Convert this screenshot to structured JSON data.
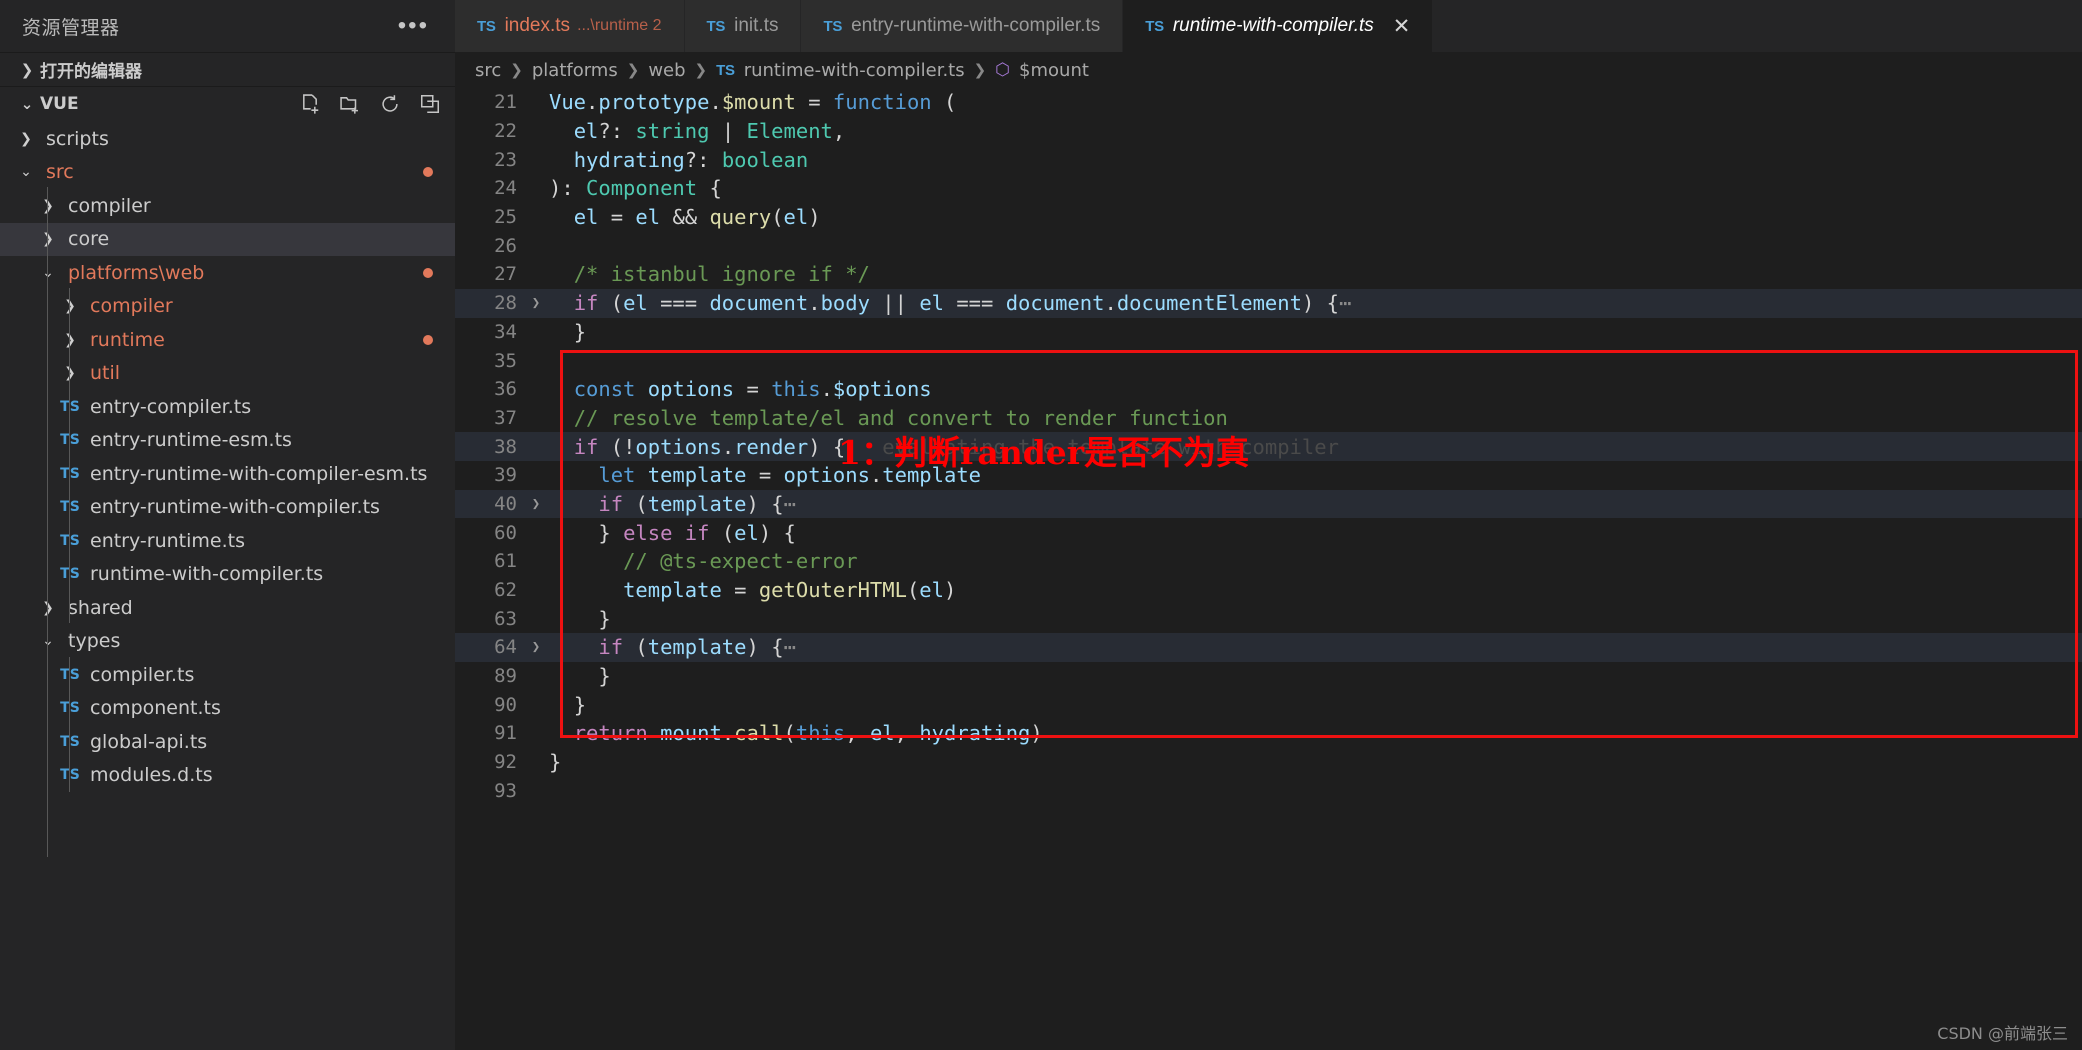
{
  "sidebar": {
    "title": "资源管理器",
    "more_label": "•••",
    "open_editors": {
      "label": "打开的编辑器",
      "chevron": "❯"
    },
    "project": {
      "label": "VUE",
      "chevron": "⌄",
      "actions": [
        "new-file-icon",
        "new-folder-icon",
        "refresh-icon",
        "collapse-all-icon"
      ]
    },
    "items": [
      {
        "name": "scripts",
        "type": "folder",
        "depth": 1,
        "state": "collapsed",
        "modified": false,
        "color": "normal"
      },
      {
        "name": "src",
        "type": "folder",
        "depth": 1,
        "state": "expanded",
        "modified": true,
        "color": "mod"
      },
      {
        "name": "compiler",
        "type": "folder",
        "depth": 2,
        "state": "collapsed",
        "modified": false,
        "color": "normal"
      },
      {
        "name": "core",
        "type": "folder",
        "depth": 2,
        "state": "collapsed",
        "modified": false,
        "color": "normal",
        "selected": true
      },
      {
        "name": "platforms\\web",
        "type": "folder",
        "depth": 2,
        "state": "expanded",
        "modified": true,
        "color": "mod"
      },
      {
        "name": "compiler",
        "type": "folder",
        "depth": 3,
        "state": "collapsed",
        "modified": false,
        "color": "mod"
      },
      {
        "name": "runtime",
        "type": "folder",
        "depth": 3,
        "state": "collapsed",
        "modified": true,
        "color": "mod"
      },
      {
        "name": "util",
        "type": "folder",
        "depth": 3,
        "state": "collapsed",
        "modified": false,
        "color": "mod"
      },
      {
        "name": "entry-compiler.ts",
        "type": "file",
        "depth": 3,
        "modified": false,
        "color": "normal"
      },
      {
        "name": "entry-runtime-esm.ts",
        "type": "file",
        "depth": 3,
        "modified": false,
        "color": "normal"
      },
      {
        "name": "entry-runtime-with-compiler-esm.ts",
        "type": "file",
        "depth": 3,
        "modified": false,
        "color": "normal"
      },
      {
        "name": "entry-runtime-with-compiler.ts",
        "type": "file",
        "depth": 3,
        "modified": false,
        "color": "normal"
      },
      {
        "name": "entry-runtime.ts",
        "type": "file",
        "depth": 3,
        "modified": false,
        "color": "normal"
      },
      {
        "name": "runtime-with-compiler.ts",
        "type": "file",
        "depth": 3,
        "modified": false,
        "color": "normal"
      },
      {
        "name": "shared",
        "type": "folder",
        "depth": 2,
        "state": "collapsed",
        "modified": false,
        "color": "normal"
      },
      {
        "name": "types",
        "type": "folder",
        "depth": 2,
        "state": "expanded",
        "modified": false,
        "color": "normal"
      },
      {
        "name": "compiler.ts",
        "type": "file",
        "depth": 3,
        "modified": false,
        "color": "normal"
      },
      {
        "name": "component.ts",
        "type": "file",
        "depth": 3,
        "modified": false,
        "color": "normal"
      },
      {
        "name": "global-api.ts",
        "type": "file",
        "depth": 3,
        "modified": false,
        "color": "normal"
      },
      {
        "name": "modules.d.ts",
        "type": "file",
        "depth": 3,
        "modified": false,
        "color": "normal"
      }
    ]
  },
  "tabs": [
    {
      "badge": "TS",
      "label": "index.ts",
      "desc": "...\\runtime 2",
      "active": false,
      "modified": true,
      "italic": false,
      "close": false
    },
    {
      "badge": "TS",
      "label": "init.ts",
      "desc": "",
      "active": false,
      "modified": false,
      "italic": false,
      "close": false
    },
    {
      "badge": "TS",
      "label": "entry-runtime-with-compiler.ts",
      "desc": "",
      "active": false,
      "modified": false,
      "italic": false,
      "close": false
    },
    {
      "badge": "TS",
      "label": "runtime-with-compiler.ts",
      "desc": "",
      "active": true,
      "modified": false,
      "italic": true,
      "close": true,
      "close_glyph": "✕"
    }
  ],
  "breadcrumb": {
    "separator": "❯",
    "parts": [
      "src",
      "platforms",
      "web"
    ],
    "file_badge": "TS",
    "file": "runtime-with-compiler.ts",
    "symbol_icon": "cube-icon",
    "symbol": "$mount"
  },
  "code_lines": [
    {
      "n": "21",
      "fold": "",
      "hl": false,
      "indent": 0
    },
    {
      "n": "22",
      "fold": "",
      "hl": false,
      "indent": 1
    },
    {
      "n": "23",
      "fold": "",
      "hl": false,
      "indent": 1
    },
    {
      "n": "24",
      "fold": "",
      "hl": false,
      "indent": 0
    },
    {
      "n": "25",
      "fold": "",
      "hl": false,
      "indent": 1
    },
    {
      "n": "26",
      "fold": "",
      "hl": false,
      "indent": 1
    },
    {
      "n": "27",
      "fold": "",
      "hl": false,
      "indent": 1
    },
    {
      "n": "28",
      "fold": "❯",
      "hl": true,
      "indent": 1
    },
    {
      "n": "34",
      "fold": "",
      "hl": false,
      "indent": 1
    },
    {
      "n": "35",
      "fold": "",
      "hl": false,
      "indent": 1
    },
    {
      "n": "36",
      "fold": "",
      "hl": false,
      "indent": 1
    },
    {
      "n": "37",
      "fold": "",
      "hl": false,
      "indent": 1
    },
    {
      "n": "38",
      "fold": "",
      "hl": true,
      "indent": 1
    },
    {
      "n": "39",
      "fold": "",
      "hl": false,
      "indent": 2
    },
    {
      "n": "40",
      "fold": "❯",
      "hl": true,
      "indent": 2
    },
    {
      "n": "60",
      "fold": "",
      "hl": false,
      "indent": 2
    },
    {
      "n": "61",
      "fold": "",
      "hl": false,
      "indent": 3
    },
    {
      "n": "62",
      "fold": "",
      "hl": false,
      "indent": 3
    },
    {
      "n": "63",
      "fold": "",
      "hl": false,
      "indent": 2
    },
    {
      "n": "64",
      "fold": "❯",
      "hl": true,
      "indent": 2
    },
    {
      "n": "89",
      "fold": "",
      "hl": false,
      "indent": 2
    },
    {
      "n": "90",
      "fold": "",
      "hl": false,
      "indent": 1
    },
    {
      "n": "91",
      "fold": "",
      "hl": false,
      "indent": 1
    },
    {
      "n": "92",
      "fold": "",
      "hl": false,
      "indent": 0
    },
    {
      "n": "93",
      "fold": "",
      "hl": false,
      "indent": 0
    }
  ],
  "code_text": {
    "l21": "Vue.prototype.$mount = function (",
    "l22": "  el?: string | Element,",
    "l23": "  hydrating?: boolean",
    "l24": "): Component {",
    "l25": "  el = el && query(el)",
    "l26": "",
    "l27": "  /* istanbul ignore if */",
    "l28": "  if (el === document.body || el === document.documentElement) {⋯",
    "l34": "  }",
    "l35": "",
    "l36": "  const options = this.$options",
    "l37": "  // resolve template/el and convert to render function",
    "l38": "  if (!options.render) {",
    "l38_ghost": "evaluating the template with compiler",
    "l39": "    let template = options.template",
    "l40": "    if (template) {⋯",
    "l60": "    } else if (el) {",
    "l61": "      // @ts-expect-error",
    "l62": "      template = getOuterHTML(el)",
    "l63": "    }",
    "l64": "    if (template) {⋯",
    "l89": "    }",
    "l90": "  }",
    "l91": "  return mount.call(this, el, hydrating)",
    "l92": "}",
    "l93": ""
  },
  "annotation": {
    "text": "1：判断rander是否不为真",
    "color": "#ff0000",
    "box_color": "#ee1111"
  },
  "watermark": "CSDN @前端张三",
  "colors": {
    "editor_bg": "#1e1e1e",
    "sidebar_bg": "#252526",
    "tab_inactive_bg": "#2d2d2d",
    "modified_fg": "#e2795b",
    "ts_badge": "#4a9fd8",
    "selection_bg": "#37373d",
    "line_highlight": "#282c34"
  }
}
